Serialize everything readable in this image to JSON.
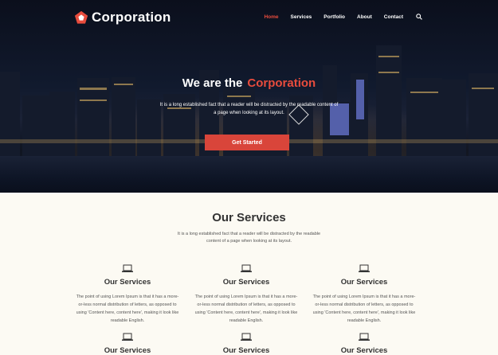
{
  "brand": {
    "name": "Corporation"
  },
  "nav": {
    "items": [
      {
        "label": "Home",
        "active": true
      },
      {
        "label": "Services",
        "active": false
      },
      {
        "label": "Portfolio",
        "active": false
      },
      {
        "label": "About",
        "active": false
      },
      {
        "label": "Contact",
        "active": false
      }
    ],
    "search_icon": "search-icon"
  },
  "hero": {
    "title_lead": "We are the",
    "title_accent": "Corporation",
    "subtitle": "It is a long established fact that a reader will be distracted by the readable content of a page when looking at its layout.",
    "cta_label": "Get Started"
  },
  "services": {
    "title": "Our Services",
    "subtitle": "It is a long established fact that a reader will be distracted by the readable content of a page when looking at its layout.",
    "cards": [
      {
        "icon": "laptop-icon",
        "title": "Our Services",
        "text": "The point of using Lorem Ipsum is that it has a more-or-less normal distribution of letters, as opposed to using 'Content here, content here', making it look like readable English."
      },
      {
        "icon": "laptop-icon",
        "title": "Our Services",
        "text": "The point of using Lorem Ipsum is that it has a more-or-less normal distribution of letters, as opposed to using 'Content here, content here', making it look like readable English."
      },
      {
        "icon": "laptop-icon",
        "title": "Our Services",
        "text": "The point of using Lorem Ipsum is that it has a more-or-less normal distribution of letters, as opposed to using 'Content here, content here', making it look like readable English."
      },
      {
        "icon": "laptop-icon",
        "title": "Our Services",
        "text": ""
      },
      {
        "icon": "laptop-icon",
        "title": "Our Services",
        "text": ""
      },
      {
        "icon": "laptop-icon",
        "title": "Our Services",
        "text": ""
      }
    ]
  },
  "colors": {
    "accent": "#e84c3d",
    "button": "#d9453a",
    "background": "#fcfaf3"
  }
}
